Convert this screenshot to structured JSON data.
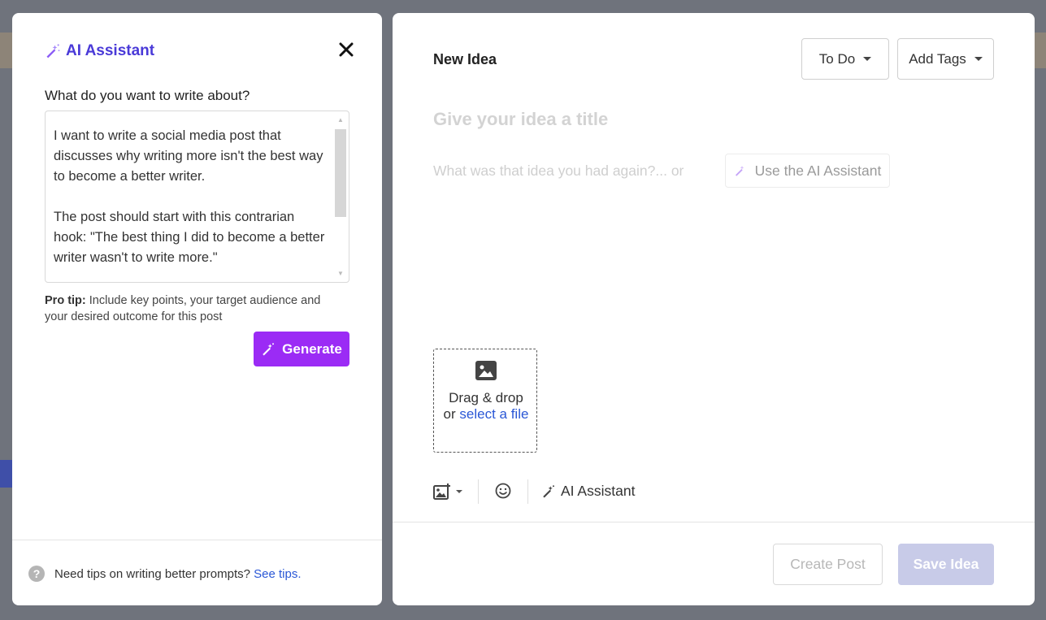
{
  "ai_assistant": {
    "title": "AI Assistant",
    "close_label": "✕",
    "prompt_label": "What do you want to write about?",
    "prompt_value": "I want to write a social media post that discusses why writing more isn't the best way to become a better writer.\n\nThe post should start with this contrarian hook: \"The best thing I did to become a better writer wasn't to write more.\"",
    "pro_tip_bold": "Pro tip:",
    "pro_tip_text": " Include key points, your target audience and your desired outcome for this post",
    "generate_label": "Generate",
    "help_text": "Need tips on writing better prompts?",
    "see_tips_label": "See tips."
  },
  "new_idea": {
    "heading": "New Idea",
    "status_label": "To Do",
    "tags_label": "Add Tags",
    "title_placeholder": "Give your idea a title",
    "body_placeholder": "What was that idea you had again?... or",
    "use_ai_label": "Use the AI Assistant",
    "dropzone": {
      "line1": "Drag & drop",
      "or": "or ",
      "link": "select a file"
    },
    "toolbar_ai_label": "AI Assistant",
    "create_post_label": "Create Post",
    "save_idea_label": "Save Idea"
  },
  "colors": {
    "accent_purple": "#9b2bf5",
    "title_blue": "#4a3ad8",
    "link_blue": "#2a57d6",
    "save_disabled": "#c8cbe8"
  },
  "icons": {
    "wand": "magic-wand-icon",
    "close": "close-icon",
    "image": "image-icon",
    "media": "add-media-icon",
    "emoji": "emoji-icon",
    "help": "help-icon",
    "caret": "caret-down-icon"
  }
}
